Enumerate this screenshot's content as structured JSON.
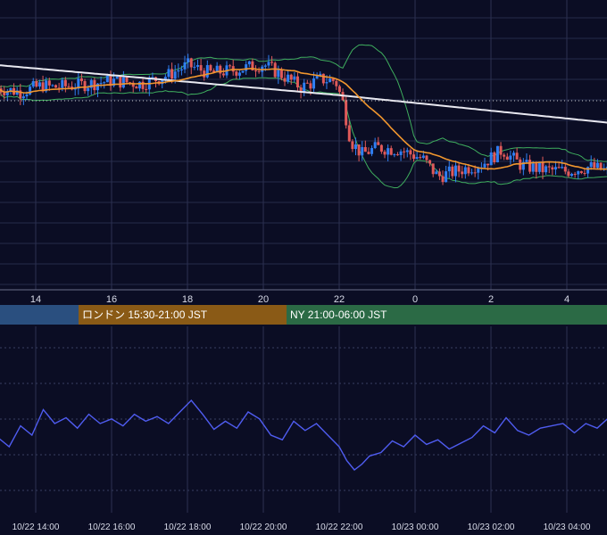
{
  "chart_data": [
    {
      "type": "candlestick",
      "description_overlays": [
        "bollinger-bands",
        "orange-moving-average",
        "white-moving-average",
        "dotted-horizontal-level"
      ],
      "x_ticks": [
        "14",
        "16",
        "18",
        "20",
        "22",
        "0",
        "2",
        "4"
      ],
      "grid": true,
      "colors": {
        "up": "#2f7ef2",
        "down": "#e05a5a",
        "bb": "#3fae5e",
        "ma_short": "#f0962e",
        "ma_long": "#e8e8f0",
        "level": "#c8c8c8"
      },
      "sessions": [
        {
          "label": "",
          "color": "#2a4f7f"
        },
        {
          "label": "ロンドン 15:30-21:00 JST",
          "color": "#8a5a16"
        },
        {
          "label": "NY 21:00-06:00 JST",
          "color": "#2b6a45"
        }
      ],
      "close_path": [
        [
          13.0,
          0.38
        ],
        [
          13.6,
          0.3
        ],
        [
          14.2,
          0.45
        ],
        [
          14.4,
          0.4
        ],
        [
          15.0,
          0.44
        ],
        [
          15.6,
          0.5
        ],
        [
          16.0,
          0.55
        ],
        [
          16.8,
          0.48
        ],
        [
          17.5,
          0.68
        ],
        [
          18.0,
          0.9
        ],
        [
          18.6,
          0.72
        ],
        [
          19.2,
          0.78
        ],
        [
          20.0,
          0.92
        ],
        [
          20.6,
          0.62
        ],
        [
          21.0,
          0.4
        ],
        [
          21.5,
          0.58
        ],
        [
          21.9,
          0.55
        ],
        [
          22.1,
          0.05
        ],
        [
          22.3,
          -0.8
        ],
        [
          22.6,
          -1.1
        ],
        [
          23.0,
          -0.95
        ],
        [
          23.6,
          -1.0
        ],
        [
          24.2,
          -1.2
        ],
        [
          24.6,
          -1.6
        ],
        [
          25.2,
          -1.45
        ],
        [
          25.8,
          -1.3
        ],
        [
          26.3,
          -1.0
        ],
        [
          26.8,
          -1.35
        ],
        [
          27.4,
          -1.45
        ],
        [
          28.0,
          -1.48
        ],
        [
          28.6,
          -1.38
        ],
        [
          29.2,
          -1.5
        ],
        [
          29.8,
          -1.46
        ]
      ]
    },
    {
      "type": "line",
      "x_ticks": [
        "10/22 14:00",
        "10/22 16:00",
        "10/22 18:00",
        "10/22 20:00",
        "10/22 22:00",
        "10/23 00:00",
        "10/23 02:00",
        "10/23 04:00"
      ],
      "grid": true,
      "color": "#4f5cf0",
      "ylim": [
        0,
        100
      ],
      "values": [
        [
          13.0,
          38
        ],
        [
          13.3,
          30
        ],
        [
          13.6,
          48
        ],
        [
          13.9,
          40
        ],
        [
          14.2,
          62
        ],
        [
          14.5,
          50
        ],
        [
          14.8,
          55
        ],
        [
          15.1,
          46
        ],
        [
          15.4,
          58
        ],
        [
          15.7,
          50
        ],
        [
          16.0,
          54
        ],
        [
          16.3,
          48
        ],
        [
          16.6,
          58
        ],
        [
          16.9,
          52
        ],
        [
          17.2,
          56
        ],
        [
          17.5,
          50
        ],
        [
          17.8,
          60
        ],
        [
          18.1,
          70
        ],
        [
          18.4,
          58
        ],
        [
          18.7,
          45
        ],
        [
          19.0,
          52
        ],
        [
          19.3,
          46
        ],
        [
          19.6,
          60
        ],
        [
          19.9,
          54
        ],
        [
          20.2,
          40
        ],
        [
          20.5,
          36
        ],
        [
          20.8,
          52
        ],
        [
          21.1,
          44
        ],
        [
          21.4,
          50
        ],
        [
          21.7,
          40
        ],
        [
          22.0,
          30
        ],
        [
          22.2,
          18
        ],
        [
          22.4,
          10
        ],
        [
          22.6,
          15
        ],
        [
          22.8,
          22
        ],
        [
          23.1,
          25
        ],
        [
          23.4,
          35
        ],
        [
          23.7,
          30
        ],
        [
          24.0,
          40
        ],
        [
          24.3,
          32
        ],
        [
          24.6,
          36
        ],
        [
          24.9,
          28
        ],
        [
          25.2,
          33
        ],
        [
          25.5,
          38
        ],
        [
          25.8,
          48
        ],
        [
          26.1,
          42
        ],
        [
          26.4,
          55
        ],
        [
          26.7,
          44
        ],
        [
          27.0,
          40
        ],
        [
          27.3,
          46
        ],
        [
          27.6,
          48
        ],
        [
          27.9,
          50
        ],
        [
          28.2,
          42
        ],
        [
          28.5,
          50
        ],
        [
          28.8,
          46
        ],
        [
          29.1,
          55
        ],
        [
          29.4,
          44
        ],
        [
          29.7,
          40
        ],
        [
          30.0,
          42
        ]
      ]
    }
  ]
}
